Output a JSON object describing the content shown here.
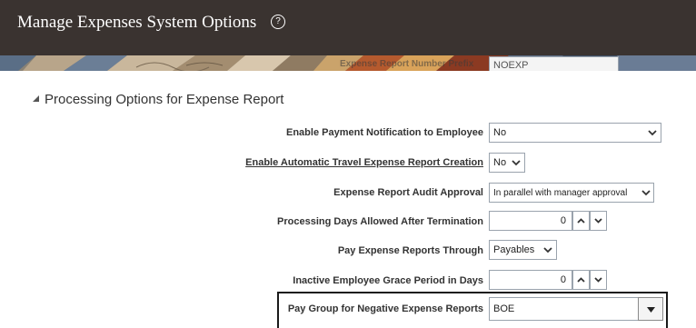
{
  "header": {
    "title": "Manage Expenses System Options",
    "help_icon": "?"
  },
  "banner": {
    "partial_field_label": "Expense Report Number Prefix",
    "partial_field_value": "NOEXP"
  },
  "section": {
    "title": "Processing Options for Expense Report"
  },
  "rows": [
    {
      "label": "Enable Payment Notification to Employee",
      "value": "No",
      "type": "select"
    },
    {
      "label": "Enable Automatic Travel Expense Report Creation",
      "value": "No",
      "type": "select"
    },
    {
      "label": "Expense Report Audit Approval",
      "value": "In parallel with manager approval",
      "type": "select"
    },
    {
      "label": "Processing Days Allowed After Termination",
      "value": "0",
      "type": "number"
    },
    {
      "label": "Pay Expense Reports Through",
      "value": "Payables",
      "type": "select"
    },
    {
      "label": "Inactive Employee Grace Period in Days",
      "value": "0",
      "type": "number"
    },
    {
      "label": "Pay Group for Negative Expense Reports",
      "value": "BOE",
      "type": "combo"
    }
  ],
  "colors": {
    "title_bar": "#3a3330",
    "field_border": "#9aa3ad"
  }
}
